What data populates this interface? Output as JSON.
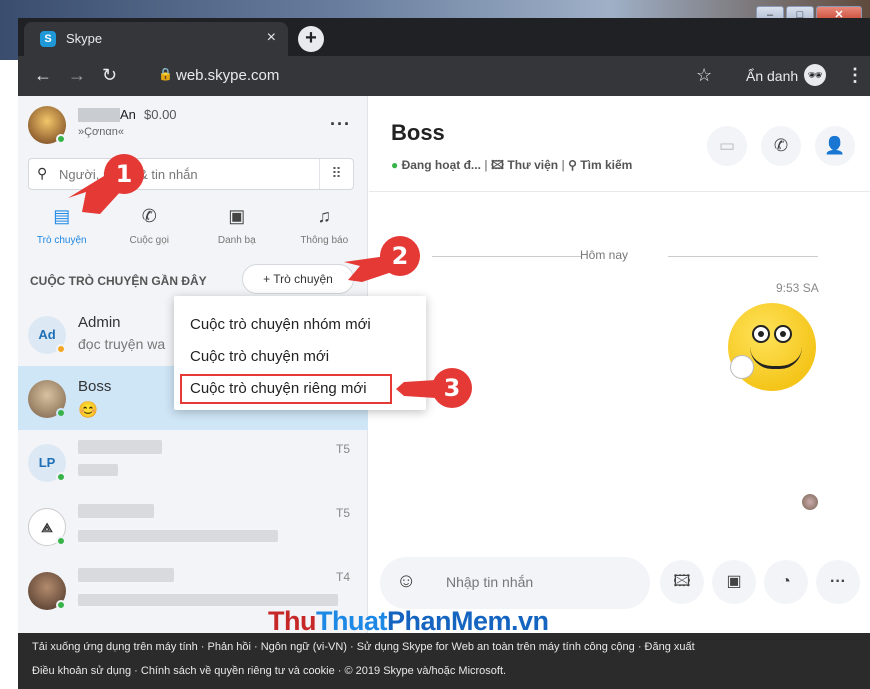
{
  "browser": {
    "tab_title": "Skype",
    "favicon": "S",
    "tab_close": "×",
    "new_tab": "+",
    "url": "web.skype.com",
    "incognito_label": "Ẩn danh",
    "window_buttons": [
      "–",
      "□",
      "✕"
    ]
  },
  "profile": {
    "name": "An",
    "credit": "$0.00",
    "mood": "»Çơnαn«",
    "more": "···"
  },
  "search": {
    "placeholder": "Người, nhóm & tin nhắn"
  },
  "nav_tabs": [
    {
      "label": "Trò chuyện",
      "icon": "chat-icon"
    },
    {
      "label": "Cuộc gọi",
      "icon": "phone-icon"
    },
    {
      "label": "Danh bạ",
      "icon": "contacts-icon"
    },
    {
      "label": "Thông báo",
      "icon": "bell-icon"
    }
  ],
  "recent": {
    "title": "CUỘC TRÒ CHUYỆN GẦN ĐÂY",
    "new_chat_label": "+ Trò chuyện"
  },
  "conversations": [
    {
      "name": "Admin",
      "initials": "Ad",
      "preview": "đọc truyện wa",
      "time": ""
    },
    {
      "name": "Boss",
      "initials": "",
      "preview": "",
      "time": ""
    },
    {
      "name": "",
      "initials": "LP",
      "preview": "",
      "time": "T5"
    },
    {
      "name": "",
      "initials": "",
      "preview": "",
      "time": "T5"
    },
    {
      "name": "",
      "initials": "",
      "preview": "",
      "time": "T4"
    }
  ],
  "dropdown": {
    "items": [
      "Cuộc trò chuyện nhóm mới",
      "Cuộc trò chuyện mới",
      "Cuộc trò chuyện riêng mới"
    ]
  },
  "chat": {
    "title": "Boss",
    "status": "Đang hoạt đ...",
    "gallery": "Thư viện",
    "find": "Tìm kiếm",
    "date_separator": "Hôm nay",
    "message_time": "9:53 SA",
    "composer_placeholder": "Nhập tin nhắn"
  },
  "annotations": [
    "1",
    "2",
    "3"
  ],
  "footer": {
    "line1": "Tải xuống ứng dụng trên máy tính  ·  Phản hồi  ·  Ngôn ngữ (vi-VN)  ·  Sử dụng Skype for Web an toàn trên máy tính công cộng  ·  Đăng xuất",
    "line2": "Điều khoản sử dụng  ·  Chính sách về quyền riêng tư và cookie  ·  © 2019 Skype và/hoặc Microsoft."
  },
  "watermark": {
    "part1": "Thu",
    "part2": "Thuat",
    "part3": "PhanMem.vn"
  },
  "colors": {
    "accent": "#1e88e5",
    "online": "#38b34a",
    "annotation": "#e53935"
  }
}
